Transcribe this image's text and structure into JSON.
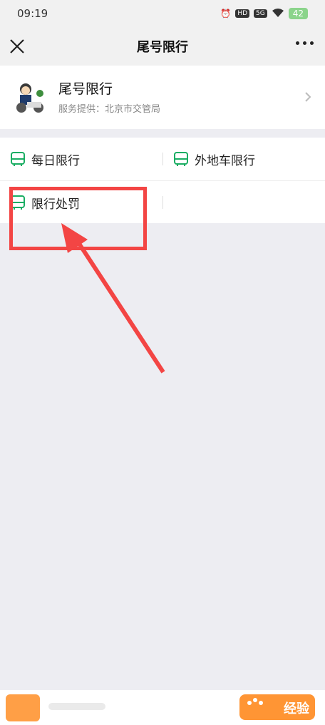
{
  "status": {
    "time": "09:19",
    "icons": [
      "alarm-icon",
      "hd-icon",
      "5g-icon",
      "wifi-icon"
    ],
    "badge_hd": "HD",
    "badge_5g": "5G",
    "battery": "42"
  },
  "navbar": {
    "title": "尾号限行"
  },
  "profile": {
    "name": "尾号限行",
    "provider": "服务提供：北京市交管局"
  },
  "menu": {
    "items": [
      {
        "label": "每日限行",
        "icon": "bus-icon"
      },
      {
        "label": "外地车限行",
        "icon": "bus-icon"
      },
      {
        "label": "限行处罚",
        "icon": "bus-icon"
      }
    ]
  },
  "annotation": {
    "color": "#F34544"
  },
  "watermark": {
    "brand": "经验"
  },
  "colors": {
    "accent_green": "#1AAD63",
    "highlight_red": "#F34544",
    "background": "#EDEDF2"
  }
}
